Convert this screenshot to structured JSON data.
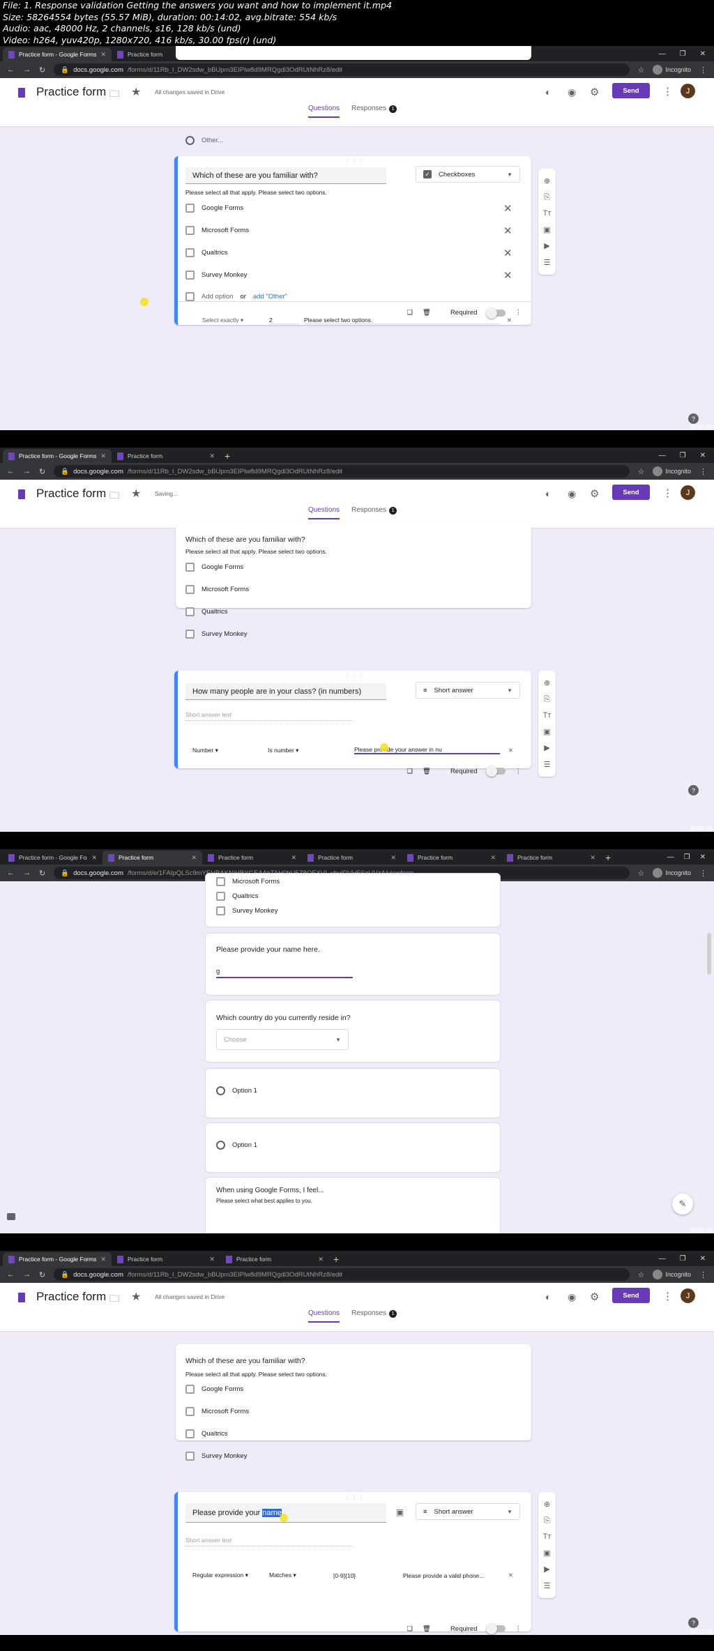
{
  "meta_header": {
    "line1": "File: 1. Response validation Getting the answers you want and how to implement it.mp4",
    "line2": "Size: 58264554 bytes (55.57 MiB), duration: 00:14:02, avg.bitrate: 554 kb/s",
    "line3": "Audio: aac, 48000 Hz, 2 channels, s16, 128 kb/s (und)",
    "line4": "Video: h264, yuv420p, 1280x720, 416 kb/s, 30.00 fps(r) (und)"
  },
  "common": {
    "tab_forms": "Practice form - Google Forms",
    "tab_practice": "Practice form",
    "incognito": "Incognito",
    "form_title": "Practice form",
    "send": "Send",
    "avatar": "J",
    "questions_tab": "Questions",
    "responses_tab": "Responses",
    "responses_count": "1",
    "desc_two": "Please select all that apply. Please select two options.",
    "q_familiar": "Which of these are you familiar with?",
    "opts": [
      "Google Forms",
      "Microsoft Forms",
      "Qualtrics",
      "Survey Monkey"
    ],
    "required": "Required",
    "short_answer": "Short answer",
    "short_answer_text": "Short answer text",
    "checkboxes": "Checkboxes"
  },
  "frame1": {
    "url_host": "docs.google.com",
    "url_path": "/forms/d/11Rb_l_DW2sdw_bBUpm3EIPlw8d9MRQgdl3OdRUtNhRz8/edit",
    "saved": "All changes saved in Drive",
    "other": "Other...",
    "add_option": "Add option",
    "or": "or",
    "add_other": "add \"Other\"",
    "val_select": "Select exactly",
    "val_num": "2",
    "val_error": "Please select  two options.",
    "timestamp": "00:02:50"
  },
  "frame2": {
    "url_host": "docs.google.com",
    "url_path": "/forms/d/11Rb_l_DW2sdw_bBUpm3EIPlw8d9MRQgdl3OdRUtNhRz8/edit",
    "saved": "Saving...",
    "q_people": "How many people are in your class? (in numbers)",
    "val_type": "Number",
    "val_cond": "Is number",
    "val_error": "Please provide your answer in nu",
    "timestamp": "00:05:38"
  },
  "frame3": {
    "url_host": "docs.google.com",
    "url_path": "/forms/d/e/1FAIpQLSc9mYEHBAKNjHBYGEAAkTAH0bU5Z8QEXVI_yhulDVH5SqUVzA/viewform",
    "tabs": [
      "Practice form - Google Forms",
      "Practice form",
      "Practice form",
      "Practice form",
      "Practice form",
      "Practice form"
    ],
    "opt_ms": "Microsoft Forms",
    "opt_q": "Qualtrics",
    "opt_sm": "Survey Monkey",
    "q_name": "Please provide your name here.",
    "name_value": "g",
    "q_country": "Which country do you currently reside in?",
    "choose": "Choose",
    "option1": "Option 1",
    "q_feel": "When using Google Forms, I feel...",
    "feel_desc": "Please select what best applies to you.",
    "timestamp": "00:08:26"
  },
  "frame4": {
    "url_host": "docs.google.com",
    "url_path": "/forms/d/11Rb_l_DW2sdw_bBUpm3EIPlw8d9MRQgdl3OdRUtNhRz8/edit",
    "saved": "All changes saved in Drive",
    "q_name_prefix": "Please provide your ",
    "q_name_sel": "name",
    "val_type": "Regular expression",
    "val_cond": "Matches",
    "val_pattern": "[0-9]{10}",
    "val_error": "Please provide a valid phone...",
    "timestamp": "00:11:14"
  }
}
